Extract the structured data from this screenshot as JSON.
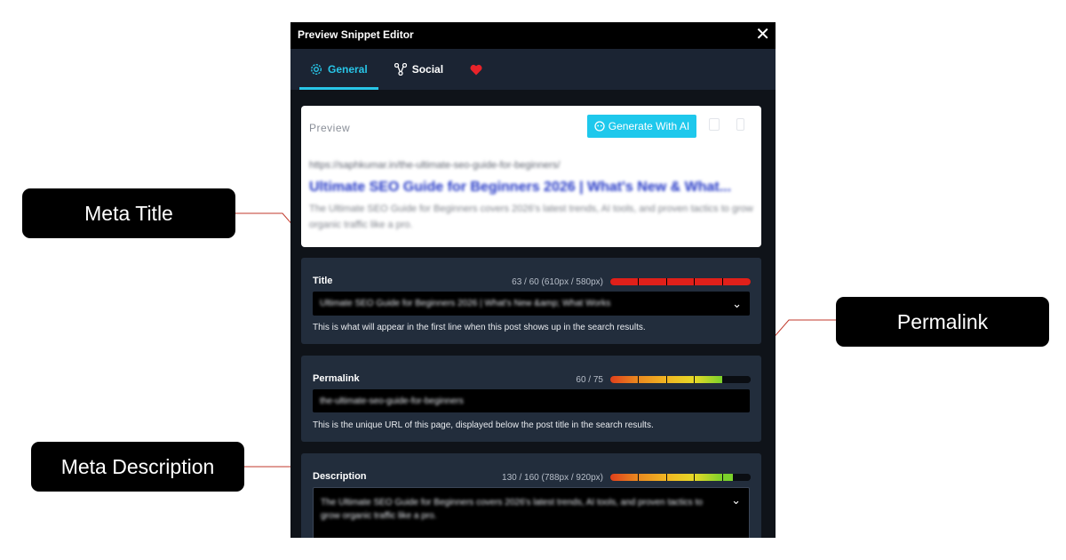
{
  "window": {
    "title": "Preview Snippet Editor",
    "close_label": "✕"
  },
  "tabs": [
    {
      "label": "General",
      "active": true
    },
    {
      "label": "Social",
      "active": false
    },
    {
      "label": "",
      "active": false
    }
  ],
  "preview": {
    "label": "Preview",
    "generate_label": "Generate With AI",
    "url": "https://saphkumar.in/the-ultimate-seo-guide-for-beginners/",
    "title": "Ultimate SEO Guide for Beginners 2026 | What's New & What...",
    "description": "The Ultimate SEO Guide for Beginners covers 2026's latest trends, AI tools, and proven tactics to grow organic traffic like a pro."
  },
  "fields": {
    "title": {
      "label": "Title",
      "counter": "63 / 60 (610px / 580px)",
      "value": "Ultimate SEO Guide for Beginners 2026 | What's New &amp; What Works",
      "help": "This is what will appear in the first line when this post shows up in the search results.",
      "meter_fill": 1.0
    },
    "permalink": {
      "label": "Permalink",
      "counter": "60 / 75",
      "value": "the-ultimate-seo-guide-for-beginners",
      "help": "This is the unique URL of this page, displayed below the post title in the search results.",
      "meter_fill": 0.8
    },
    "description": {
      "label": "Description",
      "counter": "130 / 160 (788px / 920px)",
      "value": "The Ultimate SEO Guide for Beginners covers 2026's latest trends, AI tools, and proven tactics to grow organic traffic like a pro.",
      "meter_fill": 0.87
    }
  },
  "callouts": {
    "meta_title": "Meta Title",
    "permalink": "Permalink",
    "meta_description": "Meta Description"
  },
  "colors": {
    "accent": "#28c6e8",
    "callout_line": "#c0392b",
    "meter_red": "#e0201a",
    "meter_green": "#7bd12b"
  }
}
